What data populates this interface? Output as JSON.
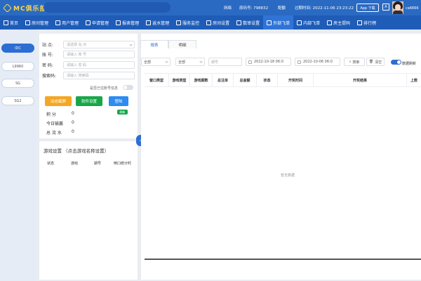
{
  "header": {
    "logo_text": "MC俱乐部",
    "network_label": "网络",
    "agent_label": "原码号: 798832",
    "quota_label": "配额",
    "expire_label": "过期时间: 2022-11-06 23:23:22",
    "app_button": "App 下载",
    "lang_button": "A",
    "username": "ca6666"
  },
  "nav": {
    "items": [
      {
        "label": "首页",
        "icon": "home-icon"
      },
      {
        "label": "房间管理",
        "icon": "rooms-icon"
      },
      {
        "label": "用户管理",
        "icon": "user-icon"
      },
      {
        "label": "申请管理",
        "icon": "apply-icon"
      },
      {
        "label": "报表管理",
        "icon": "chart-icon"
      },
      {
        "label": "返水管理",
        "icon": "tag-icon"
      },
      {
        "label": "服务监控",
        "icon": "monitor-icon"
      },
      {
        "label": "房间设置",
        "icon": "settings-icon"
      },
      {
        "label": "数审设置",
        "icon": "shield-icon"
      },
      {
        "label": "外部飞单",
        "icon": "send-icon"
      },
      {
        "label": "内部飞单",
        "icon": "sync-icon"
      },
      {
        "label": "房主提码",
        "icon": "code-icon"
      },
      {
        "label": "排行榜",
        "icon": "rank-icon"
      }
    ],
    "active_index": 9
  },
  "left_tabs": [
    "IDC",
    "L9960",
    "SG",
    "SG2"
  ],
  "form": {
    "site_label": "站 点:",
    "site_placeholder": "请选择 站 点",
    "account_label": "账 号:",
    "account_placeholder": "请输入 账 号",
    "password_label": "密 码:",
    "password_placeholder": "请输入 密 码",
    "captcha_label": "搜索码:",
    "captcha_placeholder": "请输入 搜索码",
    "save_label": "是否已住账号信息"
  },
  "actions": {
    "auto_fly": "动态截屏",
    "software_settings": "软件设置",
    "login": "登陆"
  },
  "actions_colors": {
    "auto_fly": "#f5a623",
    "software_settings": "#19a64a",
    "login": "#2d8cf0"
  },
  "stats": {
    "points_label": "积 分",
    "points_value": "0",
    "today_label": "今日输赢",
    "today_value": "0",
    "water_label": "总 流 水",
    "water_value": "0",
    "refresh_label": "刷新"
  },
  "game_settings": {
    "title": "游戏设置 （点击游戏名称设置）",
    "columns": [
      "状态",
      "游戏",
      "期号",
      "倒口统计时"
    ]
  },
  "tabs": [
    "报表",
    "明细"
  ],
  "filters": {
    "all_1": "全部",
    "all_2": "全部",
    "period_placeholder": "期号",
    "date_start": "2022-10-18 06:0",
    "date_end": "2022-10-06 06:0",
    "search": "搜索",
    "clear": "清空",
    "auto_refresh_label": "数据刷新"
  },
  "table": {
    "columns": [
      "窗口类型",
      "游戏类型",
      "游戏期数",
      "总注单",
      "总金额",
      "状态",
      "开奖时间",
      "开奖结果",
      "上数"
    ],
    "empty_text": "暂无数据"
  }
}
